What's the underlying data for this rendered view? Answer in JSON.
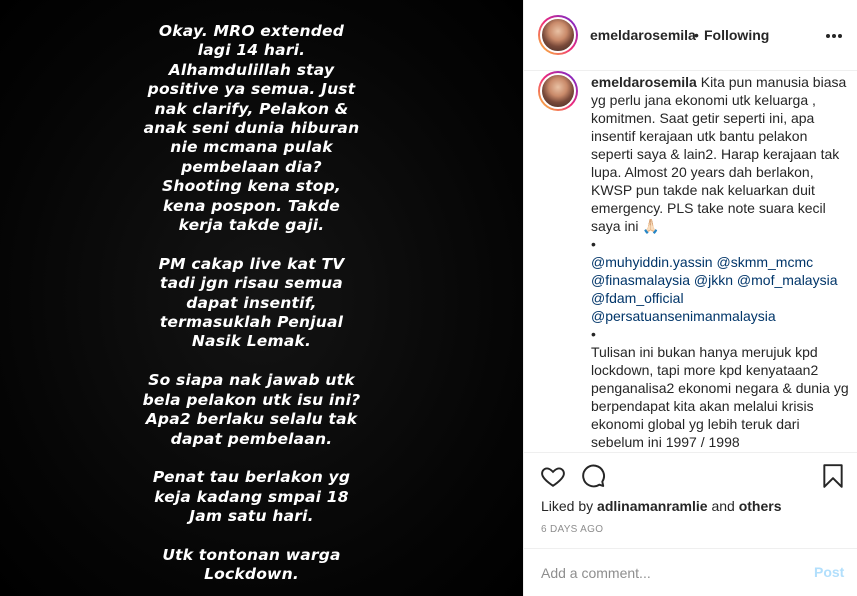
{
  "post": {
    "story_lines": [
      "Okay. MRO extended",
      "lagi 14 hari.",
      "Alhamdulillah stay",
      "positive ya semua. Just",
      "nak clarify, Pelakon &",
      "anak seni dunia hiburan",
      "nie mcmana pulak",
      "pembelaan dia?",
      "Shooting kena stop,",
      "kena pospon. Takde",
      "kerja takde gaji.",
      "",
      "PM cakap live kat TV",
      "tadi jgn risau semua",
      "dapat insentif,",
      "termasuklah Penjual",
      "Nasik Lemak.",
      "",
      "So siapa nak jawab utk",
      "bela pelakon utk isu ini?",
      "Apa2 berlaku selalu tak",
      "dapat pembelaan.",
      "",
      "Penat tau berlakon yg",
      "keja kadang smpai 18",
      "Jam satu hari.",
      "",
      "Utk tontonan warga",
      "Lockdown."
    ]
  },
  "header": {
    "username": "emeldarosemila",
    "separator": "•",
    "following": "Following",
    "more_icon": "more-horizontal-icon"
  },
  "caption": {
    "username": "emeldarosemila",
    "text": "Kita pun manusia biasa yg perlu jana ekonomi utk keluarga , komitmen. Saat getir seperti ini, apa insentif kerajaan utk bantu pelakon seperti saya & lain2. Harap kerajaan tak lupa. Almost 20 years dah berlakon, KWSP pun takde nak keluarkan duit emergency. PLS take note suara kecil saya ini 🙏🏻",
    "bullet1": "•",
    "mention_lines": [
      "@muhyiddin.yassin @skmm_mcmc",
      "@finasmalaysia @jkkn @mof_malaysia",
      "@fdam_official",
      "@persatuansenimanmalaysia"
    ],
    "bullet2": "•",
    "text2": "Tulisan ini bukan hanya merujuk kpd lockdown, tapi more kpd kenyataan2 penganalisa2 ekonomi negara & dunia yg berpendapat kita akan melalui krisis ekonomi global yg lebih teruk dari sebelum ini 1997 / 1998"
  },
  "actions": {
    "liked_by_prefix": "Liked by",
    "liked_by_user": "adlinamanramlie",
    "liked_by_and": "and",
    "liked_by_others": "others",
    "time_ago": "6 DAYS AGO"
  },
  "comment_box": {
    "placeholder": "Add a comment...",
    "post_label": "Post"
  }
}
